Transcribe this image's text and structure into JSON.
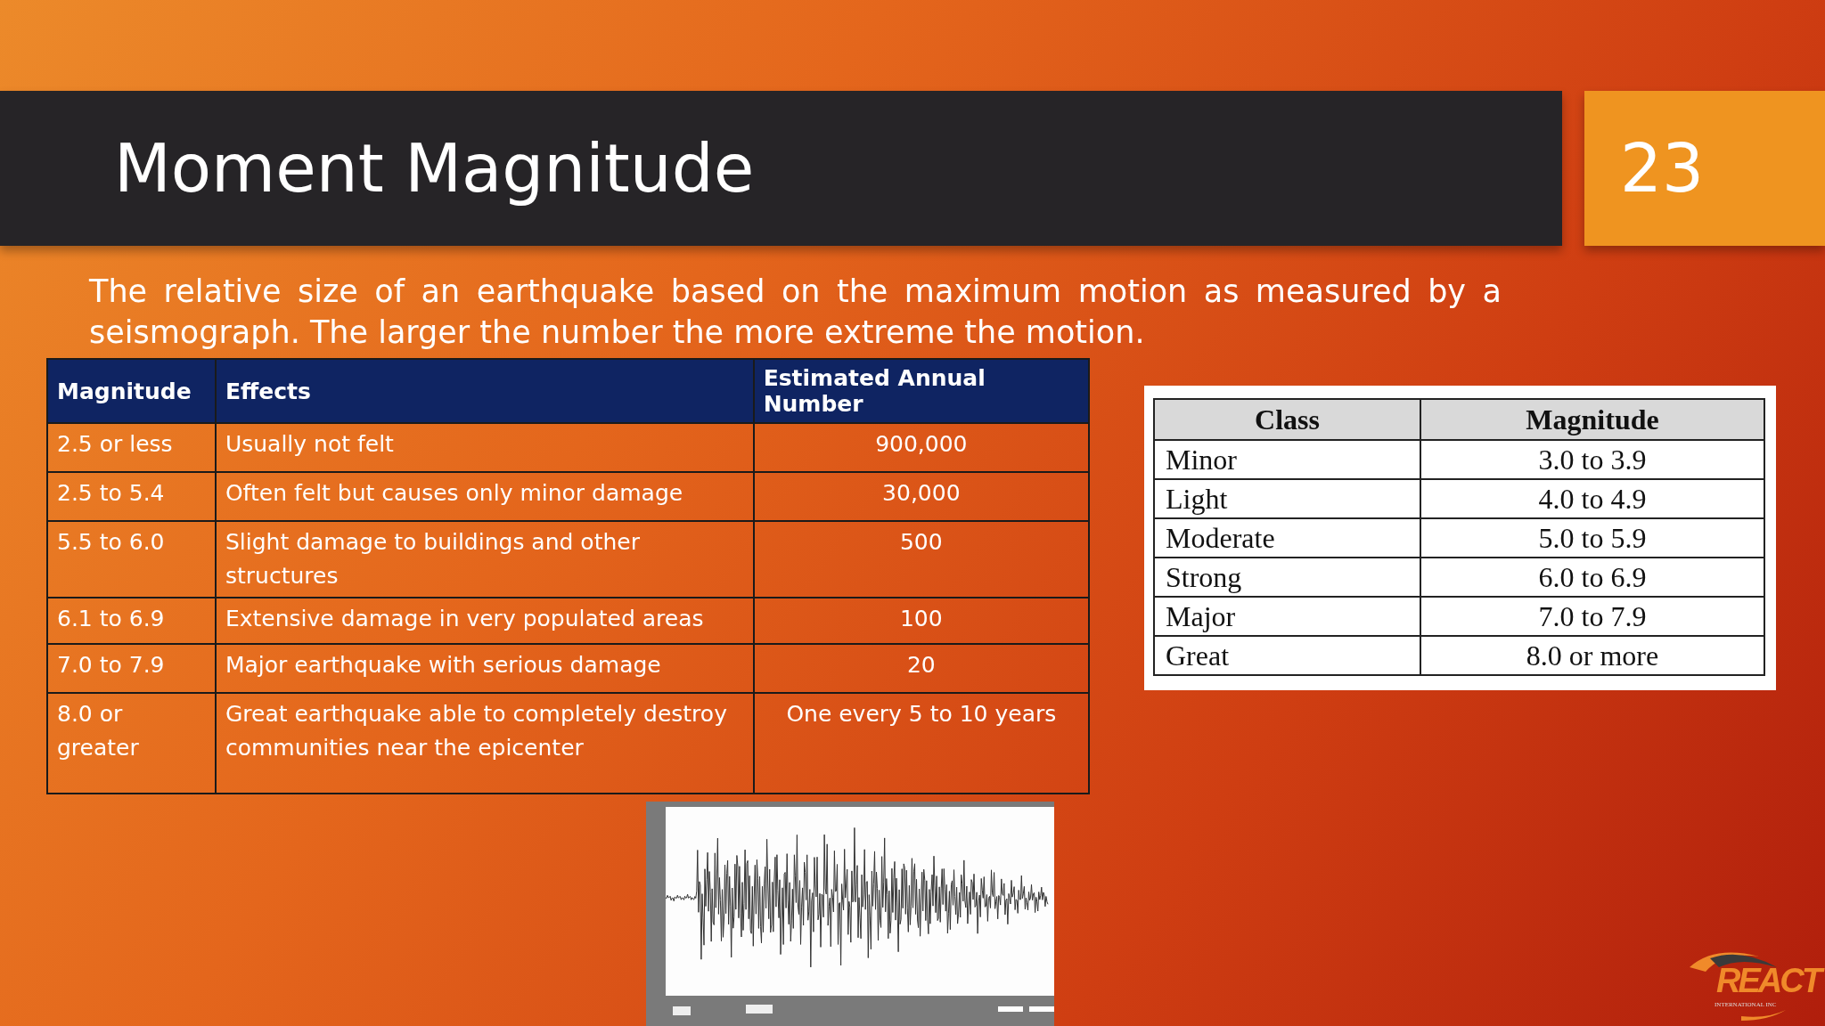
{
  "slide": {
    "title": "Moment Magnitude",
    "number": "23",
    "description": "The relative size of an earthquake based on the maximum motion as measured by a seismograph. The larger the number the more extreme the motion."
  },
  "effects_table": {
    "columns": [
      "Magnitude",
      "Effects",
      "Estimated Annual Number"
    ],
    "rows": [
      [
        "2.5 or less",
        "Usually not felt",
        "900,000"
      ],
      [
        "2.5 to 5.4",
        "Often felt but causes only minor damage",
        "30,000"
      ],
      [
        "5.5 to 6.0",
        "Slight damage to buildings and other structures",
        "500"
      ],
      [
        "6.1 to 6.9",
        "Extensive damage in very populated areas",
        "100"
      ],
      [
        "7.0 to 7.9",
        "Major earthquake with serious damage",
        "20"
      ],
      [
        "8.0 or greater",
        "Great earthquake able to completely destroy communities near the epicenter",
        "One every 5 to 10 years"
      ]
    ]
  },
  "class_table": {
    "columns": [
      "Class",
      "Magnitude"
    ],
    "rows": [
      [
        "Minor",
        "3.0 to 3.9"
      ],
      [
        "Light",
        "4.0 to 4.9"
      ],
      [
        "Moderate",
        "5.0 to 5.9"
      ],
      [
        "Strong",
        "6.0 to 6.9"
      ],
      [
        "Major",
        "7.0 to 7.9"
      ],
      [
        "Great",
        "8.0 or more"
      ]
    ]
  },
  "logo": {
    "name": "REACT",
    "tagline": "INTERNATIONAL INC"
  }
}
